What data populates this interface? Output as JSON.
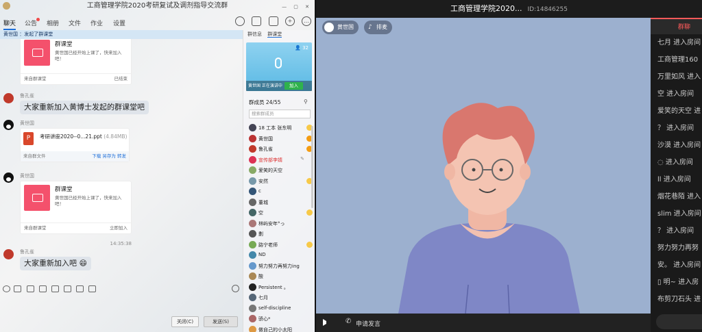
{
  "qq": {
    "title": "工商管理学院2020考研复试及调剂指导交流群",
    "tabs": [
      "聊天",
      "公告",
      "相册",
      "文件",
      "作业",
      "设置"
    ],
    "notice": "黄世国 ：发起了群课堂",
    "cards": [
      {
        "title": "群课堂",
        "desc": "黄世国已经开始上课了，快来加入吧！",
        "source": "来自群课堂",
        "status": "已结束"
      },
      {
        "title": "群课堂",
        "desc": "黄世国已经开始上课了，快来加入吧！",
        "source": "来自群课堂",
        "status": "立即加入"
      }
    ],
    "messages": {
      "u1": "鲁孔雀",
      "m1": "大家重新加入黄博士发起的群课堂吧",
      "u2": "黄世国",
      "file_name": "考研讲座2020--0...21.ppt",
      "file_size": "(4.84MB)",
      "file_source": "来自群文件",
      "file_actions": "下载  另存为  转发",
      "u3": "黄世国",
      "time": "14:35:38",
      "u4": "鲁孔雀",
      "m2": "大家重新加入吧"
    },
    "buttons": {
      "close": "关闭(C)",
      "send": "发送(S)"
    },
    "right": {
      "tabs": [
        "群信息",
        "群课堂"
      ],
      "voice_count": "32",
      "voice_status": "黄世国 正在演讲中",
      "join": "加入",
      "members_header": "群成员 24/55",
      "search_placeholder": "搜索群成员",
      "members": [
        "18 工本 张东明",
        "黄世国",
        "鲁孔雀",
        "宣传部李婧",
        "爱笑的天空",
        "安然",
        "c",
        "董城",
        "空",
        "林屿安年°っ",
        "劃",
        "路宁老师",
        "ND",
        "努力努力再努力ing",
        "酸",
        "Persistent 。",
        "七月",
        "self-discipline",
        "骄心*",
        "做自己的小太阳"
      ]
    }
  },
  "video": {
    "title": "工商管理学院2020...",
    "room_id": "ID:14846255",
    "presenter": "黄世国",
    "queue": "排麦",
    "apply": "申请发言",
    "panel_tab": "群聊",
    "entries": [
      "七月 进入房间",
      "工商管理160",
      "万里如风 进入",
      "空 进入房间",
      "爱笑的天空 进",
      "？ 进入房间",
      "沙漠 进入房间",
      "◌ 进入房间",
      "ll 进入房间",
      "烟花巷陌 进入",
      "slim 进入房间",
      "？ 进入房间",
      "努力努力再努",
      "安。 进入房间",
      "▯ 明~ 进入房",
      "布剪刀石头 进"
    ]
  },
  "colors": {
    "accent": "#1e6fd9",
    "card_icon": "#f4516c",
    "stage_bg": "#9cb0cf",
    "panel_tab": "#ff5a5a"
  }
}
